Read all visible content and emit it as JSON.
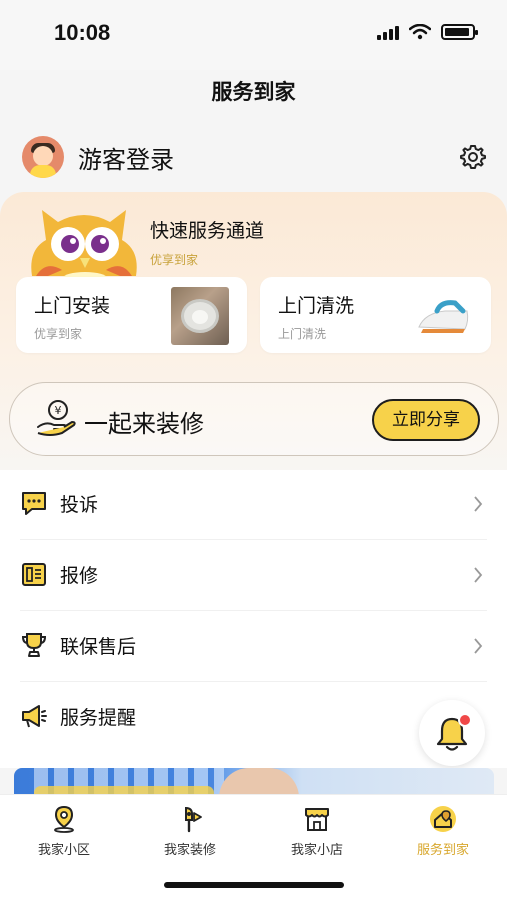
{
  "status": {
    "time": "10:08"
  },
  "header": {
    "title": "服务到家"
  },
  "profile": {
    "login_label": "游客登录"
  },
  "quick_service": {
    "title": "快速服务通道",
    "subtitle": "优享到家",
    "cards": [
      {
        "title": "上门安装",
        "subtitle": "优享到家"
      },
      {
        "title": "上门清洗",
        "subtitle": "上门清洗"
      }
    ]
  },
  "share": {
    "label": "一起来装修",
    "button_label": "立即分享"
  },
  "menu": {
    "items": [
      {
        "label": "投诉",
        "icon": "message-icon"
      },
      {
        "label": "报修",
        "icon": "repair-icon"
      },
      {
        "label": "联保售后",
        "icon": "trophy-icon"
      },
      {
        "label": "服务提醒",
        "icon": "megaphone-icon"
      }
    ]
  },
  "tabbar": {
    "items": [
      {
        "label": "我家小区",
        "icon": "location-pin-icon"
      },
      {
        "label": "我家装修",
        "icon": "brush-icon"
      },
      {
        "label": "我家小店",
        "icon": "store-icon"
      },
      {
        "label": "服务到家",
        "icon": "home-service-icon",
        "active": true
      }
    ]
  },
  "colors": {
    "accent": "#f7d24a",
    "accent_text": "#d8a72c",
    "alert": "#f04848"
  }
}
